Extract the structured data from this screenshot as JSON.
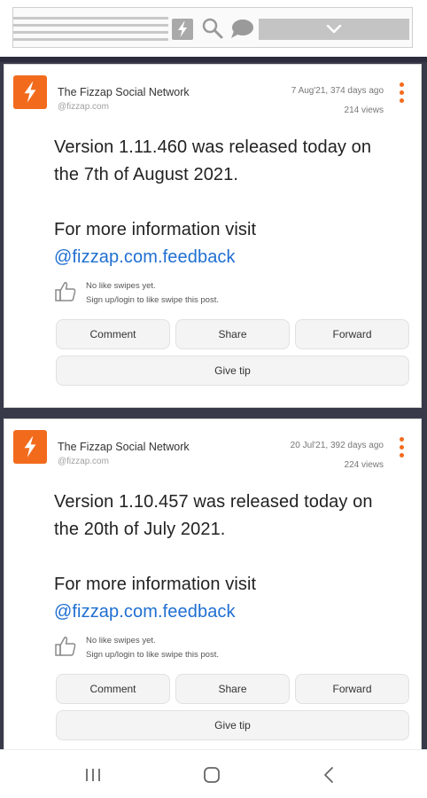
{
  "topbar": {
    "icons": [
      "menu-lines",
      "zap-icon",
      "search-icon",
      "chat-bubble-icon",
      "chevron-down-icon"
    ]
  },
  "posts": [
    {
      "network_name": "The Fizzap Social Network",
      "handle": "@fizzap.com",
      "date": "7 Aug'21, 374 days ago",
      "views": "214 views",
      "line1": "Version 1.11.460 was released today on",
      "line2": "the 7th of August 2021.",
      "line3": "For more information visit",
      "link": "@fizzap.com.feedback",
      "like_line1": "No like swipes yet.",
      "like_line2": "Sign up/login to like swipe this post.",
      "comment_label": "Comment",
      "share_label": "Share",
      "forward_label": "Forward",
      "tip_label": "Give tip"
    },
    {
      "network_name": "The Fizzap Social Network",
      "handle": "@fizzap.com",
      "date": "20 Jul'21, 392 days ago",
      "views": "224 views",
      "line1": "Version 1.10.457 was released today on",
      "line2": "the 20th of July 2021.",
      "line3": "For more information visit",
      "link": "@fizzap.com.feedback",
      "like_line1": "No like swipes yet.",
      "like_line2": "Sign up/login to like swipe this post.",
      "comment_label": "Comment",
      "share_label": "Share",
      "forward_label": "Forward",
      "tip_label": "Give tip"
    }
  ],
  "colors": {
    "brand": "#f26b1d",
    "link": "#1f6fd1",
    "feed_background": "#383a4a"
  },
  "navbar": {
    "icons": [
      "recents-icon",
      "home-icon",
      "back-icon"
    ]
  }
}
